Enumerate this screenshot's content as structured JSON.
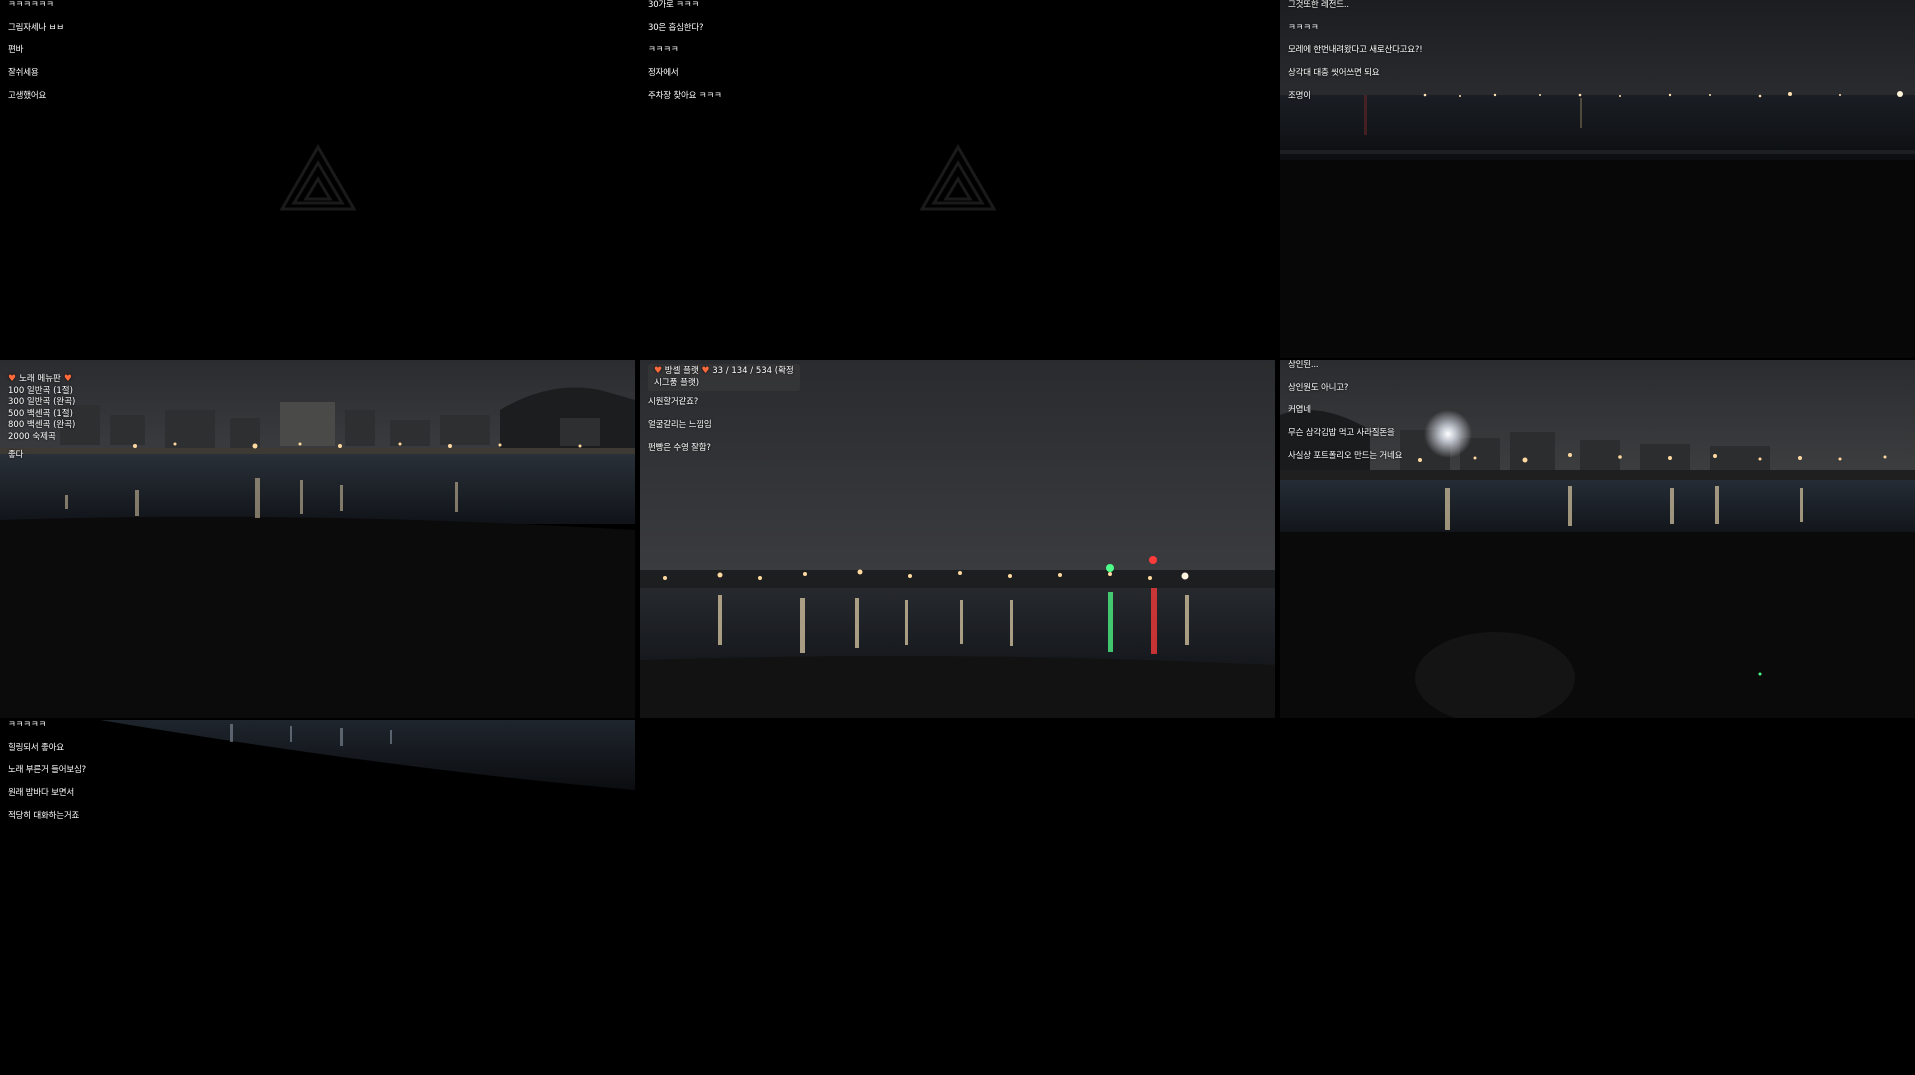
{
  "tiles": [
    {
      "id": "tile-1",
      "chat": [
        "ㅋㅋㅋㅋㅋㅋ",
        "그림자세나 ㅂㅂ",
        "편바",
        "잘쉬세용",
        "고생했어요"
      ]
    },
    {
      "id": "tile-2",
      "chat": [
        "30가로 ㅋㅋㅋ",
        "30은 흡심한다?",
        "ㅋㅋㅋㅋ",
        "정자에서",
        "주차장 찾아요 ㅋㅋㅋ"
      ]
    },
    {
      "id": "tile-3",
      "chat": [
        "그것또한 레전드..",
        "ㅋㅋㅋㅋ",
        "모레에 한번내려왔다고 새로산다고요?!",
        "상각대 대충 씻어쓰면 되요",
        "조명이"
      ]
    },
    {
      "id": "tile-4",
      "menu": {
        "title": "노래 메뉴판",
        "items": [
          "100 일반곡 (1절)",
          "300 일반곡 (완곡)",
          "500 백센곡 (1절)",
          "800 백센곡 (완곡)",
          "2000 숙제곡"
        ]
      },
      "chat": [
        "좋다"
      ]
    },
    {
      "id": "tile-5",
      "overlay": {
        "title": "방셀 플랫",
        "stats": "33 / 134 / 534 (확정 시그풍 플랫)"
      },
      "chat": [
        "시원할거같죠?",
        "얼굴갈리는 느낌임",
        "펀빵은 수영 잘함?"
      ]
    },
    {
      "id": "tile-6",
      "chat": [
        "상인된...",
        "상인원도 아니고?",
        "커엽네",
        "무슨 삼각김밥 먹고 사라질돈을",
        "사실상 포트폴리오 만드는 거네요"
      ]
    },
    {
      "id": "tile-7",
      "chat": [
        "ㅋㅋㅋㅋㅋ",
        "힐링되서 좋아요",
        "노래 부른거 들어보심?",
        "원래 밤바다 보면서",
        "적당히 대화하는거죠"
      ]
    }
  ],
  "colors": {
    "background": "#000000",
    "chat_text": "#ffffff",
    "heart": "#ff6a3d",
    "sky": "#2b2c2e",
    "water": "#141a22",
    "light_warm": "#ffd9a0",
    "light_green": "#4dff88",
    "light_red": "#ff3b3b"
  }
}
